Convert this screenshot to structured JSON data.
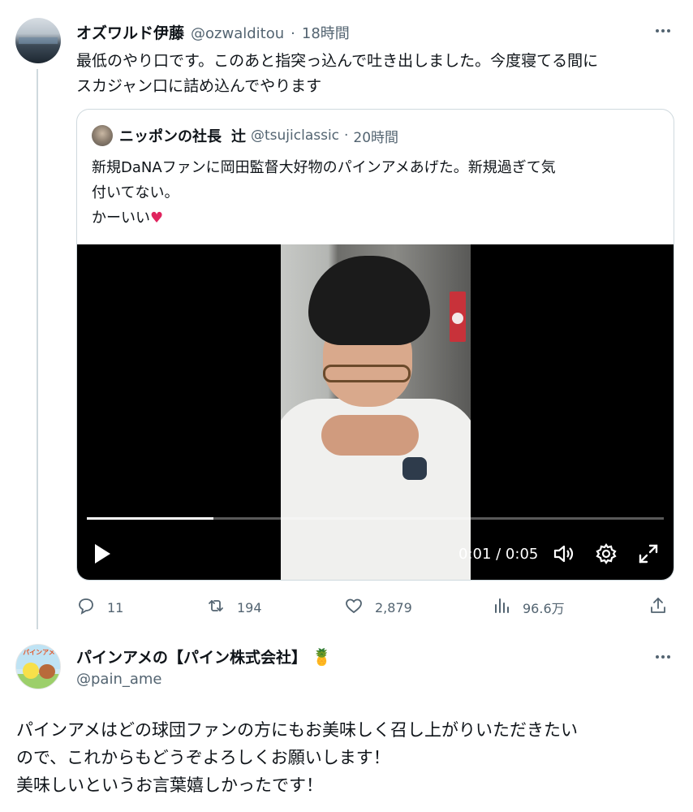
{
  "tweet": {
    "author_name": "オズワルド伊藤",
    "handle": "@ozwalditou",
    "separator": "·",
    "time": "18時間",
    "text_line1": "最低のやり口です。このあと指突っ込んで吐き出しました。今度寝てる間に",
    "text_line2": "スカジャン口に詰め込んでやります",
    "stats": {
      "replies": "11",
      "retweets": "194",
      "likes": "2,879",
      "views": "96.6万"
    }
  },
  "quote": {
    "author_name": "ニッポンの社長",
    "author_name2": "辻",
    "handle": "@tsujiclassic",
    "separator": "·",
    "time": "20時間",
    "text_line1": "新規DaNAファンに岡田監督大好物のパインアメあげた。新規過ぎて気",
    "text_line2": "付いてない。",
    "text_line3": "かーいい",
    "heart": "♥",
    "video": {
      "time_display": "0:01 / 0:05",
      "progress": 0.22
    }
  },
  "reply": {
    "avatar_text": "パインアメ",
    "author_name": "パインアメの【パイン株式会社】",
    "emoji": "🍍",
    "handle": "@pain_ame",
    "text_line1": "パインアメはどの球団ファンの方にもお美味しく召し上がりいただきたい",
    "text_line2": "ので、これからもどうぞよろしくお願いします！",
    "text_line3": "美味しいというお言葉嬉しかったです！"
  },
  "colors": {
    "text": "#0f1419",
    "secondary": "#536471",
    "border": "#cfd9de",
    "heart": "#e0245e"
  },
  "icons": [
    "more-icon",
    "play-icon",
    "volume-icon",
    "settings-icon",
    "fullscreen-icon",
    "reply-icon",
    "retweet-icon",
    "like-icon",
    "views-icon",
    "share-icon"
  ]
}
